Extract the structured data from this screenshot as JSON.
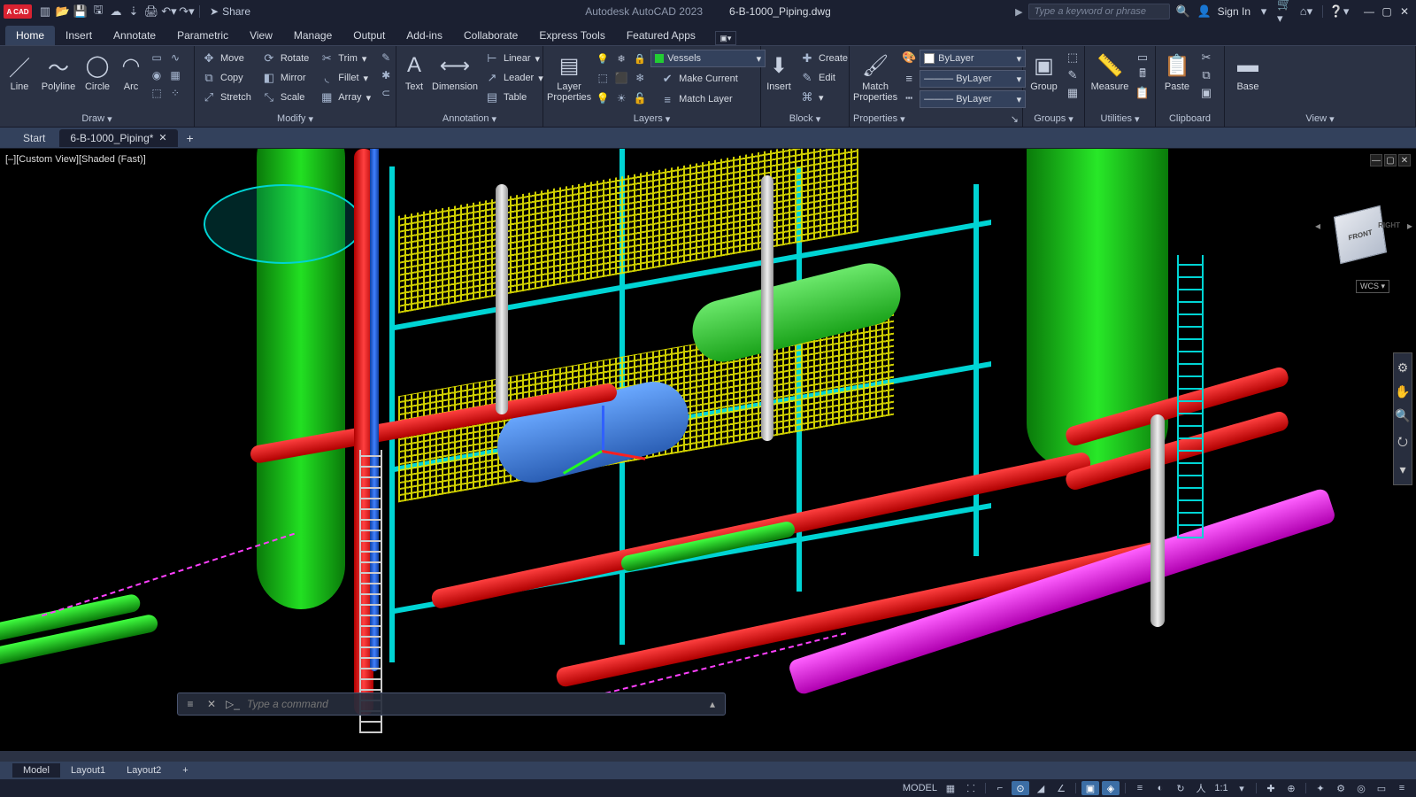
{
  "qat": {
    "share": "Share",
    "app_name": "Autodesk AutoCAD 2023",
    "file_name": "6-B-1000_Piping.dwg",
    "search_placeholder": "Type a keyword or phrase",
    "signin": "Sign In"
  },
  "tabs": [
    "Home",
    "Insert",
    "Annotate",
    "Parametric",
    "View",
    "Manage",
    "Output",
    "Add-ins",
    "Collaborate",
    "Express Tools",
    "Featured Apps"
  ],
  "active_tab": "Home",
  "ribbon": {
    "draw": {
      "title": "Draw",
      "line": "Line",
      "polyline": "Polyline",
      "circle": "Circle",
      "arc": "Arc"
    },
    "modify": {
      "title": "Modify",
      "move": "Move",
      "copy": "Copy",
      "stretch": "Stretch",
      "rotate": "Rotate",
      "mirror": "Mirror",
      "scale": "Scale",
      "trim": "Trim",
      "fillet": "Fillet",
      "array": "Array"
    },
    "annotation": {
      "title": "Annotation",
      "text": "Text",
      "dimension": "Dimension",
      "linear": "Linear",
      "leader": "Leader",
      "table": "Table"
    },
    "layers": {
      "title": "Layers",
      "layerprops": "Layer\nProperties",
      "current_layer": "Vessels",
      "makecurrent": "Make Current",
      "matchlayer": "Match Layer"
    },
    "block": {
      "title": "Block",
      "insert": "Insert",
      "create": "Create",
      "edit": "Edit"
    },
    "properties": {
      "title": "Properties",
      "match": "Match\nProperties",
      "color": "ByLayer",
      "lw": "ByLayer",
      "lt": "ByLayer"
    },
    "groups": {
      "title": "Groups",
      "group": "Group"
    },
    "utilities": {
      "title": "Utilities",
      "measure": "Measure"
    },
    "clipboard": {
      "title": "Clipboard",
      "paste": "Paste"
    },
    "view": {
      "title": "View",
      "base": "Base"
    }
  },
  "file_tabs": {
    "start": "Start",
    "doc": "6-B-1000_Piping*"
  },
  "viewport_label": "[–][Custom View][Shaded (Fast)]",
  "viewcube": {
    "front": "FRONT",
    "right": "RIGHT",
    "wcs": "WCS"
  },
  "cmd_placeholder": "Type a command",
  "layout_tabs": [
    "Model",
    "Layout1",
    "Layout2"
  ],
  "status": {
    "model": "MODEL",
    "scale": "1:1"
  }
}
